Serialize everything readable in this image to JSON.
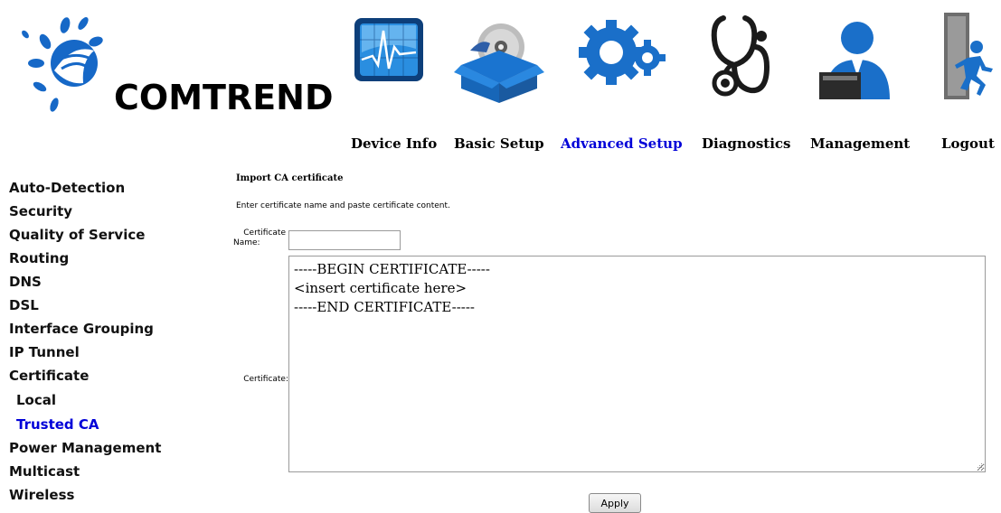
{
  "brand": {
    "logo_text": "COMTREND"
  },
  "nav": {
    "items": [
      {
        "label": "Device Info",
        "icon": "chart-monitor-icon",
        "active": false
      },
      {
        "label": "Basic Setup",
        "icon": "disc-box-icon",
        "active": false
      },
      {
        "label": "Advanced Setup",
        "icon": "gears-icon",
        "active": true
      },
      {
        "label": "Diagnostics",
        "icon": "stethoscope-icon",
        "active": false
      },
      {
        "label": "Management",
        "icon": "user-laptop-icon",
        "active": false
      },
      {
        "label": "Logout",
        "icon": "exit-door-icon",
        "active": false
      }
    ]
  },
  "sidebar": {
    "items": [
      {
        "label": "Auto-Detection",
        "sub": false,
        "active": false
      },
      {
        "label": "Security",
        "sub": false,
        "active": false
      },
      {
        "label": "Quality of Service",
        "sub": false,
        "active": false
      },
      {
        "label": "Routing",
        "sub": false,
        "active": false
      },
      {
        "label": "DNS",
        "sub": false,
        "active": false
      },
      {
        "label": "DSL",
        "sub": false,
        "active": false
      },
      {
        "label": "Interface Grouping",
        "sub": false,
        "active": false
      },
      {
        "label": "IP Tunnel",
        "sub": false,
        "active": false
      },
      {
        "label": "Certificate",
        "sub": false,
        "active": false
      },
      {
        "label": "Local",
        "sub": true,
        "active": false
      },
      {
        "label": "Trusted CA",
        "sub": true,
        "active": true
      },
      {
        "label": "Power Management",
        "sub": false,
        "active": false
      },
      {
        "label": "Multicast",
        "sub": false,
        "active": false
      },
      {
        "label": "Wireless",
        "sub": false,
        "active": false
      }
    ]
  },
  "main": {
    "title": "Import CA certificate",
    "description": "Enter certificate name and paste certificate content.",
    "name_label_line1": "Certificate",
    "name_label_line2": "Name:",
    "name_value": "",
    "certificate_label": "Certificate:",
    "certificate_value": "-----BEGIN CERTIFICATE-----\n<insert certificate here>\n-----END CERTIFICATE-----",
    "apply_label": "Apply"
  },
  "colors": {
    "active_link": "#0000d8",
    "icon_blue": "#1a6fc9",
    "icon_dark": "#1a1a1a"
  }
}
